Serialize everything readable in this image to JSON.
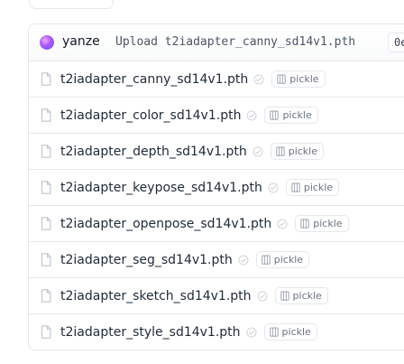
{
  "commit": {
    "author": "yanze",
    "message": "Upload t2iadapter_canny_sd14v1.pth",
    "hash": "0e"
  },
  "files": [
    {
      "name": "t2iadapter_canny_sd14v1.pth",
      "badge": "pickle"
    },
    {
      "name": "t2iadapter_color_sd14v1.pth",
      "badge": "pickle"
    },
    {
      "name": "t2iadapter_depth_sd14v1.pth",
      "badge": "pickle"
    },
    {
      "name": "t2iadapter_keypose_sd14v1.pth",
      "badge": "pickle"
    },
    {
      "name": "t2iadapter_openpose_sd14v1.pth",
      "badge": "pickle"
    },
    {
      "name": "t2iadapter_seg_sd14v1.pth",
      "badge": "pickle"
    },
    {
      "name": "t2iadapter_sketch_sd14v1.pth",
      "badge": "pickle"
    },
    {
      "name": "t2iadapter_style_sd14v1.pth",
      "badge": "pickle"
    }
  ],
  "icons": {
    "avatar": "user-avatar",
    "file": "file-icon",
    "safe": "shield-check-icon",
    "pickle": "pickle-jar-icon"
  },
  "colors": {
    "border": "#e5e7eb",
    "text": "#1f2937",
    "muted": "#9ca3af",
    "avatar_gradient": [
      "#f0abfc",
      "#a855f7",
      "#6366f1"
    ]
  }
}
